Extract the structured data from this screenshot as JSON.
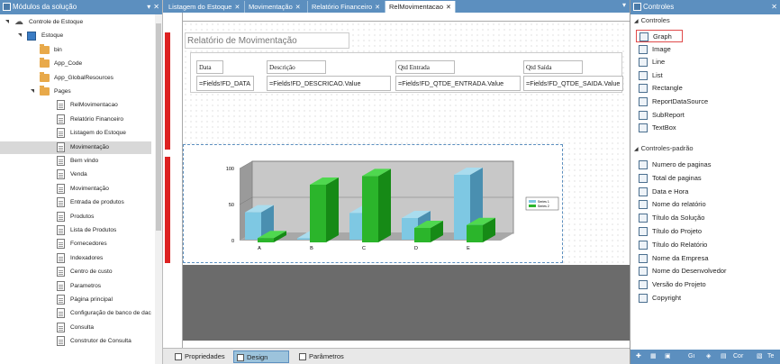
{
  "left_panel": {
    "title": "Módulos da solução",
    "tree": [
      {
        "label": "Controle de Estoque",
        "icon": "cloud-icon"
      },
      {
        "label": "Estoque",
        "icon": "project-icon"
      },
      {
        "label": "bin",
        "icon": "folder-icon"
      },
      {
        "label": "App_Code",
        "icon": "folder-icon"
      },
      {
        "label": "App_GlobalResources",
        "icon": "folder-icon"
      },
      {
        "label": "Pages",
        "icon": "folder-icon"
      },
      {
        "label": "RelMovimentacao",
        "icon": "page-icon"
      },
      {
        "label": "Relatório Financeiro",
        "icon": "page-icon"
      },
      {
        "label": "Listagem do Estoque",
        "icon": "page-icon"
      },
      {
        "label": "Movimentação",
        "icon": "page-icon"
      },
      {
        "label": "Bem vindo",
        "icon": "page-icon"
      },
      {
        "label": "Venda",
        "icon": "page-icon"
      },
      {
        "label": "Movimentação",
        "icon": "page-icon"
      },
      {
        "label": "Entrada de produtos",
        "icon": "page-icon"
      },
      {
        "label": "Produtos",
        "icon": "page-icon"
      },
      {
        "label": "Lista de Produtos",
        "icon": "page-icon"
      },
      {
        "label": "Fornecedores",
        "icon": "page-icon"
      },
      {
        "label": "Indexadores",
        "icon": "page-icon"
      },
      {
        "label": "Centro de custo",
        "icon": "page-icon"
      },
      {
        "label": "Parametros",
        "icon": "page-icon"
      },
      {
        "label": "Página principal",
        "icon": "page-icon"
      },
      {
        "label": "Configuração de banco de dac",
        "icon": "page-icon"
      },
      {
        "label": "Consulta",
        "icon": "page-icon"
      },
      {
        "label": "Construtor de Consulta",
        "icon": "page-icon"
      }
    ]
  },
  "tabs": [
    {
      "label": "Listagem do Estoque"
    },
    {
      "label": "Movimentação"
    },
    {
      "label": "Relatório Financeiro"
    },
    {
      "label": "RelMovimentacao"
    }
  ],
  "report": {
    "title": "Relatório de Movimentação",
    "headers": [
      "Data",
      "Descrição",
      "Qtd Entrada",
      "Qtd Saída"
    ],
    "fields": [
      "=Fields!FD_DATA",
      "=Fields!FD_DESCRICAO.Value",
      "=Fields!FD_QTDE_ENTRADA.Value",
      "=Fields!FD_QTDE_SAIDA.Value"
    ]
  },
  "chart_data": {
    "type": "bar",
    "categories": [
      "A",
      "B",
      "C",
      "D",
      "E"
    ],
    "series": [
      {
        "name": "Series 1",
        "values": [
          38,
          2,
          37,
          30,
          90
        ],
        "color": "#7ec8e3"
      },
      {
        "name": "Series 2",
        "values": [
          6,
          80,
          92,
          20,
          24
        ],
        "color": "#2bb52b"
      }
    ],
    "yticks": [
      "100",
      "50",
      "0"
    ],
    "ylim": [
      0,
      100
    ]
  },
  "bottom_tabs": [
    {
      "label": "Propriedades"
    },
    {
      "label": "Design"
    },
    {
      "label": "Parâmetros"
    }
  ],
  "right_panel": {
    "title": "Controles",
    "section1": "Controles",
    "controls": [
      "Graph",
      "Image",
      "Line",
      "List",
      "Rectangle",
      "ReportDataSource",
      "SubReport",
      "TextBox"
    ],
    "section2": "Controles-padrão",
    "std_controls": [
      "Numero de paginas",
      "Total de paginas",
      "Data e Hora",
      "Nome do relatório",
      "Título da Solução",
      "Título do Projeto",
      "Título do Relatório",
      "Nome da Empresa",
      "Nome do Desenvolvedor",
      "Versão do Projeto",
      "Copyright"
    ],
    "footer": [
      "Gı",
      "Cor",
      "Te"
    ]
  },
  "colors": {
    "accent": "#5c8fbf",
    "selected_border": "#e04a4a"
  }
}
